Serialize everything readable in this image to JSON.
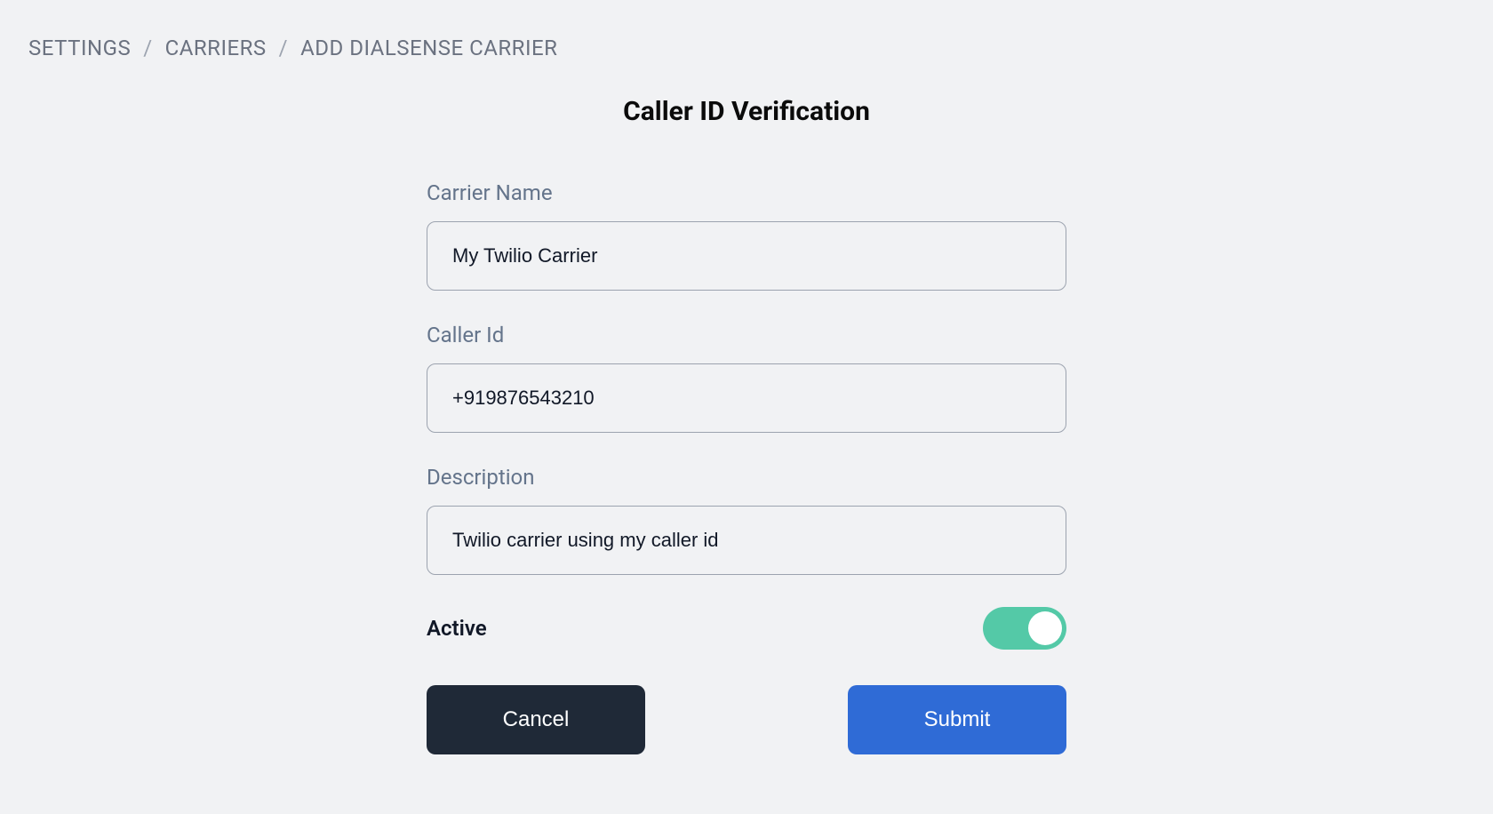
{
  "breadcrumb": {
    "items": [
      "SETTINGS",
      "CARRIERS",
      "ADD DIALSENSE CARRIER"
    ],
    "separator": "/"
  },
  "title": "Caller ID Verification",
  "form": {
    "carrier_name": {
      "label": "Carrier Name",
      "value": "My Twilio Carrier"
    },
    "caller_id": {
      "label": "Caller Id",
      "value": "+919876543210"
    },
    "description": {
      "label": "Description",
      "value": "Twilio carrier using my caller id"
    },
    "active": {
      "label": "Active",
      "value": true
    }
  },
  "buttons": {
    "cancel": "Cancel",
    "submit": "Submit"
  }
}
